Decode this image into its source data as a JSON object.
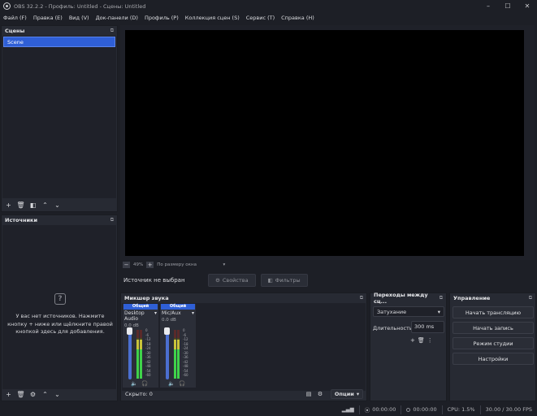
{
  "window": {
    "title": "OBS 32.2.2 - Профиль: Untitled - Сцены: Untitled",
    "min_icon": "–",
    "max_icon": "☐",
    "close_icon": "✕"
  },
  "menu": [
    "Файл (F)",
    "Правка (E)",
    "Вид (V)",
    "Док-панели (D)",
    "Профиль (P)",
    "Коллекция сцен (S)",
    "Сервис (T)",
    "Справка (H)"
  ],
  "scenes": {
    "title": "Сцены",
    "items": [
      "Scene"
    ]
  },
  "sources": {
    "title": "Источники",
    "empty_text": "У вас нет источников. Нажмите кнопку + ниже или щёлкните правой кнопкой здесь для добавления."
  },
  "preview": {
    "zoom": "49%",
    "scale_mode": "По размеру окна"
  },
  "source_bar": {
    "no_source": "Источник не выбран",
    "properties": "Свойства",
    "filters": "Фильтры"
  },
  "mixer": {
    "title": "Микшер звука",
    "channels": [
      {
        "tag": "Общий",
        "name": "Desktop Audio",
        "db": "0.0 dB",
        "level": 0.8
      },
      {
        "tag": "Общий",
        "name": "Mic/Aux",
        "db": "0.0 dB",
        "level": 0.8
      }
    ],
    "scale": [
      "0",
      "-6",
      "-12",
      "-18",
      "-24",
      "-30",
      "-36",
      "-42",
      "-48",
      "-54",
      "-60"
    ],
    "hidden_label": "Скрыто: 0",
    "options": "Опции"
  },
  "transitions": {
    "title": "Переходы между сц...",
    "selected": "Затухание",
    "duration_label": "Длительность",
    "duration_value": "300 ms"
  },
  "controls": {
    "title": "Управление",
    "start_stream": "Начать трансляцию",
    "start_record": "Начать запись",
    "studio_mode": "Режим студии",
    "settings": "Настройки"
  },
  "status": {
    "stream_time": "00:00:00",
    "record_time": "00:00:00",
    "cpu": "CPU: 1.5%",
    "fps": "30.00 / 30.00 FPS"
  },
  "colors": {
    "accent": "#2f5fd6",
    "panel": "#272a33",
    "background": "#1d1f26"
  }
}
